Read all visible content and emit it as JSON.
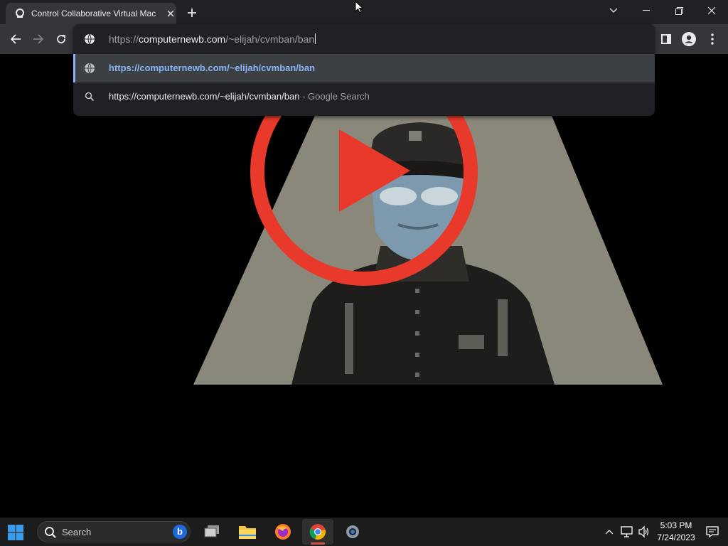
{
  "browser": {
    "tab": {
      "title": "Control Collaborative Virtual Mac",
      "icon": "cvm-logo-icon"
    },
    "new_tab_icon": "plus-icon",
    "window_controls": [
      "chevron-down-icon",
      "minimize-icon",
      "restore-icon",
      "close-icon"
    ]
  },
  "toolbar": {
    "nav": [
      "back-arrow-icon",
      "forward-arrow-icon",
      "reload-icon"
    ],
    "right": [
      "side-panel-icon",
      "profile-icon",
      "menu-kebab-icon"
    ]
  },
  "omnibox": {
    "url_dim_prefix": "https://",
    "url_main": "computernewb.com",
    "url_dim_path": "/~elijah/cvmban/ban",
    "suggestions": [
      {
        "icon": "globe-icon",
        "text": "https://computernewb.com/~elijah/cvmban/ban",
        "description": ""
      },
      {
        "icon": "search-icon",
        "text": "https://computernewb.com/~elijah/cvmban/ban",
        "description": " - Google Search"
      }
    ]
  },
  "taskbar": {
    "search_placeholder": "Search",
    "bing_letter": "b",
    "apps": [
      "windows-start-icon",
      "task-view-icon",
      "file-explorer-icon",
      "firefox-icon",
      "chrome-icon",
      "settings-icon"
    ],
    "clock_time": "5:03 PM",
    "clock_date": "7/24/2023"
  },
  "colors": {
    "accent_link": "#8ab4f8",
    "play_red": "#e8392b",
    "spotlight": "#8a877b"
  }
}
